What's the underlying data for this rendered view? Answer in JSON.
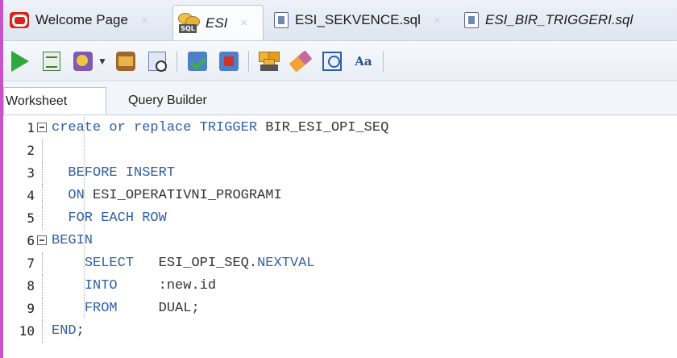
{
  "tabs": [
    {
      "label": "Welcome Page",
      "icon": "oracle-icon",
      "active": false,
      "italic": false
    },
    {
      "label": "ESI",
      "icon": "sql-worksheet-icon",
      "active": true,
      "italic": true
    },
    {
      "label": "ESI_SEKVENCE.sql",
      "icon": "sql-file-icon",
      "active": false,
      "italic": false
    },
    {
      "label": "ESI_BIR_TRIGGERI.sql",
      "icon": "sql-file-icon",
      "active": false,
      "italic": true
    }
  ],
  "close_glyph": "×",
  "toolbar": {
    "icons": [
      "run-statement-icon",
      "run-script-icon",
      "commit-icon",
      "rollback-icon",
      "sql-tuning-icon",
      "clear-icon",
      "sql-history-icon",
      "format-icon"
    ],
    "text_icon": "Aa"
  },
  "subtabs": {
    "worksheet": "Worksheet",
    "query_builder": "Query Builder"
  },
  "editor": {
    "lines": [
      {
        "num": "1",
        "fold": true,
        "tokens": [
          [
            "kw",
            "create or replace TRIGGER "
          ],
          [
            "tx",
            "BIR_ESI_OPI_SEQ"
          ]
        ]
      },
      {
        "num": "2",
        "fold": false,
        "tokens": []
      },
      {
        "num": "3",
        "fold": false,
        "tokens": [
          [
            "tx",
            "  "
          ],
          [
            "kw",
            "BEFORE INSERT"
          ]
        ]
      },
      {
        "num": "4",
        "fold": false,
        "tokens": [
          [
            "tx",
            "  "
          ],
          [
            "kw",
            "ON "
          ],
          [
            "tx",
            "ESI_OPERATIVNI_PROGRAMI"
          ]
        ]
      },
      {
        "num": "5",
        "fold": false,
        "tokens": [
          [
            "tx",
            "  "
          ],
          [
            "kw",
            "FOR EACH ROW"
          ]
        ]
      },
      {
        "num": "6",
        "fold": true,
        "tokens": [
          [
            "kw",
            "BEGIN"
          ]
        ]
      },
      {
        "num": "7",
        "fold": false,
        "tokens": [
          [
            "tx",
            "    "
          ],
          [
            "kw",
            "SELECT"
          ],
          [
            "tx",
            "   ESI_OPI_SEQ."
          ],
          [
            "kw",
            "NEXTVAL"
          ]
        ]
      },
      {
        "num": "8",
        "fold": false,
        "tokens": [
          [
            "tx",
            "    "
          ],
          [
            "kw",
            "INTO"
          ],
          [
            "tx",
            "     :new.id"
          ]
        ]
      },
      {
        "num": "9",
        "fold": false,
        "tokens": [
          [
            "tx",
            "    "
          ],
          [
            "kw",
            "FROM"
          ],
          [
            "tx",
            "     DUAL;"
          ]
        ]
      },
      {
        "num": "10",
        "fold": false,
        "tokens": [
          [
            "kw",
            "END"
          ],
          [
            "tx",
            ";"
          ]
        ]
      }
    ]
  }
}
